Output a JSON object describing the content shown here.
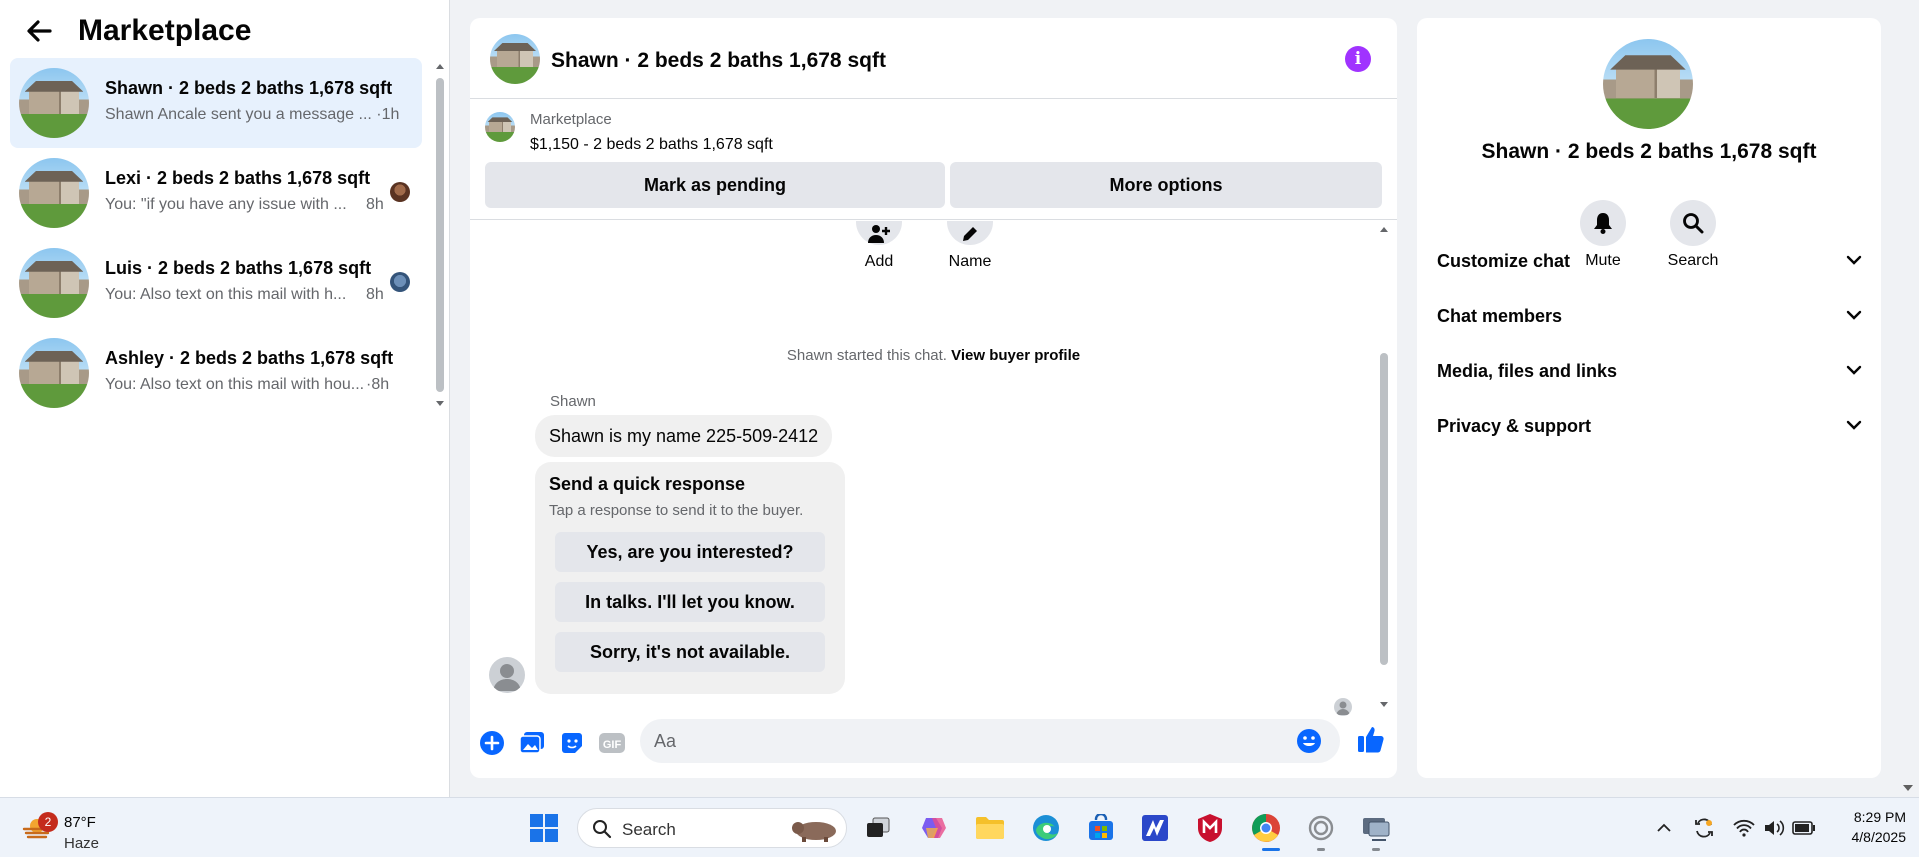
{
  "sidebar": {
    "title": "Marketplace",
    "conversations": [
      {
        "name": "Shawn · 2 beds 2 baths 1,678 sqft",
        "preview": "Shawn Ancale sent you a message ... ·1h",
        "time": "",
        "active": true
      },
      {
        "name": "Lexi · 2 beds 2 baths 1,678 sqft",
        "preview": "You: \"if you have any issue with ...",
        "time": "8h",
        "active": false
      },
      {
        "name": "Luis · 2 beds 2 baths 1,678 sqft",
        "preview": "You: Also text on this mail with h...",
        "time": "8h",
        "active": false
      },
      {
        "name": "Ashley · 2 beds 2 baths 1,678 sqft",
        "preview": "You: Also text on this mail with hou...",
        "time": "·8h",
        "active": false
      }
    ]
  },
  "chat": {
    "title": "Shawn · 2 beds 2 baths 1,678 sqft",
    "listing": {
      "source": "Marketplace",
      "price_line": "$1,150 - 2 beds 2 baths 1,678 sqft",
      "pending_label": "Mark as pending",
      "more_label": "More options"
    },
    "tools": {
      "add_label": "Add",
      "name_label": "Name"
    },
    "started_text": "Shawn started this chat.",
    "view_profile_label": "View buyer profile",
    "sender": "Shawn",
    "message": "Shawn is my name 225-509-2412",
    "quick": {
      "heading": "Send a quick response",
      "sub": "Tap a response to send it to the buyer.",
      "options": [
        "Yes, are you interested?",
        "In talks. I'll let you know.",
        "Sorry, it's not available."
      ]
    },
    "composer_placeholder": "Aa",
    "accent": "#0866ff"
  },
  "details": {
    "title": "Shawn · 2 beds 2 baths 1,678 sqft",
    "mute_label": "Mute",
    "search_label": "Search",
    "sections": [
      "Customize chat",
      "Chat members",
      "Media, files and links",
      "Privacy & support"
    ]
  },
  "taskbar": {
    "weather": {
      "badge": "2",
      "temp": "87°F",
      "condition": "Haze"
    },
    "search_label": "Search",
    "time": "8:29 PM",
    "date": "4/8/2025"
  }
}
